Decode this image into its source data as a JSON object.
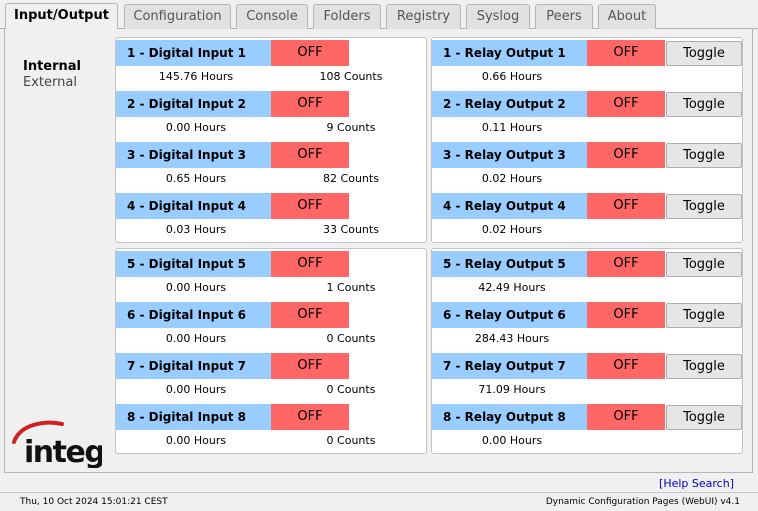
{
  "tabs": [
    {
      "label": "Input/Output",
      "active": true
    },
    {
      "label": "Configuration"
    },
    {
      "label": "Console"
    },
    {
      "label": "Folders"
    },
    {
      "label": "Registry"
    },
    {
      "label": "Syslog"
    },
    {
      "label": "Peers"
    },
    {
      "label": "About"
    }
  ],
  "sidenav": {
    "internal": "Internal",
    "external": "External"
  },
  "logo": {
    "text": "integ",
    "color": "#cc2222"
  },
  "colors": {
    "label_bg": "#99ccff",
    "off_bg": "#ff6666"
  },
  "inputs": [
    {
      "label": "1 - Digital Input 1",
      "state": "OFF",
      "hours": "145.76 Hours",
      "counts": "108 Counts"
    },
    {
      "label": "2 - Digital Input 2",
      "state": "OFF",
      "hours": "0.00 Hours",
      "counts": "9 Counts"
    },
    {
      "label": "3 - Digital Input 3",
      "state": "OFF",
      "hours": "0.65 Hours",
      "counts": "82 Counts"
    },
    {
      "label": "4 - Digital Input 4",
      "state": "OFF",
      "hours": "0.03 Hours",
      "counts": "33 Counts"
    },
    {
      "label": "5 - Digital Input 5",
      "state": "OFF",
      "hours": "0.00 Hours",
      "counts": "1 Counts"
    },
    {
      "label": "6 - Digital Input 6",
      "state": "OFF",
      "hours": "0.00 Hours",
      "counts": "0 Counts"
    },
    {
      "label": "7 - Digital Input 7",
      "state": "OFF",
      "hours": "0.00 Hours",
      "counts": "0 Counts"
    },
    {
      "label": "8 - Digital Input 8",
      "state": "OFF",
      "hours": "0.00 Hours",
      "counts": "0 Counts"
    }
  ],
  "relays": [
    {
      "label": "1 - Relay Output 1",
      "state": "OFF",
      "button": "Toggle",
      "hours": "0.66 Hours"
    },
    {
      "label": "2 - Relay Output 2",
      "state": "OFF",
      "button": "Toggle",
      "hours": "0.11 Hours"
    },
    {
      "label": "3 - Relay Output 3",
      "state": "OFF",
      "button": "Toggle",
      "hours": "0.02 Hours"
    },
    {
      "label": "4 - Relay Output 4",
      "state": "OFF",
      "button": "Toggle",
      "hours": "0.02 Hours"
    },
    {
      "label": "5 - Relay Output 5",
      "state": "OFF",
      "button": "Toggle",
      "hours": "42.49 Hours"
    },
    {
      "label": "6 - Relay Output 6",
      "state": "OFF",
      "button": "Toggle",
      "hours": "284.43 Hours"
    },
    {
      "label": "7 - Relay Output 7",
      "state": "OFF",
      "button": "Toggle",
      "hours": "71.09 Hours"
    },
    {
      "label": "8 - Relay Output 8",
      "state": "OFF",
      "button": "Toggle",
      "hours": "0.00 Hours"
    }
  ],
  "help_link": "[Help Search]",
  "status": {
    "datetime": "Thu, 10 Oct 2024 15:01:21 CEST",
    "app": "Dynamic Configuration Pages (WebUI) v4.1"
  }
}
